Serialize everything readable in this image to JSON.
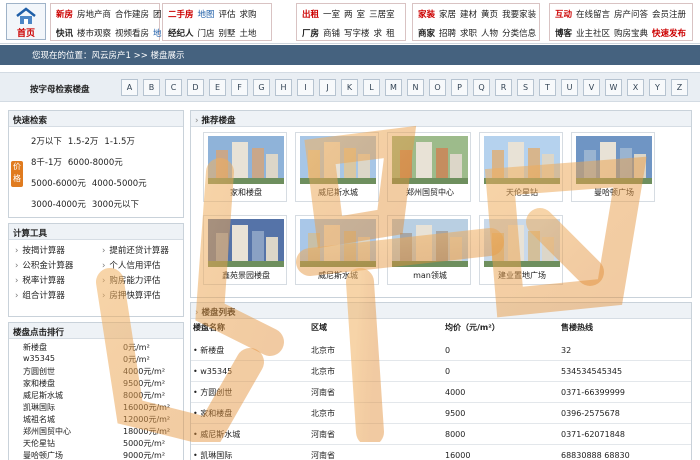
{
  "nav": {
    "home_label": "首页",
    "blocks": [
      {
        "row1": [
          {
            "t": "新房",
            "s": "red"
          },
          {
            "t": "房地产商",
            "s": ""
          },
          {
            "t": "合作建房",
            "s": ""
          },
          {
            "t": "团购",
            "s": ""
          }
        ],
        "row2": [
          {
            "t": "快讯",
            "s": "bold"
          },
          {
            "t": "楼市观察",
            "s": ""
          },
          {
            "t": "视频看房",
            "s": ""
          },
          {
            "t": "地图",
            "s": "blue"
          }
        ]
      },
      {
        "row1": [
          {
            "t": "二手房",
            "s": "red"
          },
          {
            "t": "地图",
            "s": "blue"
          },
          {
            "t": "评估",
            "s": ""
          },
          {
            "t": "求购",
            "s": ""
          }
        ],
        "row2": [
          {
            "t": "经纪人",
            "s": "bold"
          },
          {
            "t": "门店",
            "s": ""
          },
          {
            "t": "别墅",
            "s": ""
          },
          {
            "t": "土地",
            "s": ""
          }
        ]
      },
      {
        "row1": [
          {
            "t": "出租",
            "s": "red"
          },
          {
            "t": "一室",
            "s": ""
          },
          {
            "t": "两",
            "s": ""
          },
          {
            "t": "室",
            "s": ""
          },
          {
            "t": "三居室",
            "s": ""
          }
        ],
        "row2": [
          {
            "t": "厂房",
            "s": "bold"
          },
          {
            "t": "商铺",
            "s": ""
          },
          {
            "t": "写字楼",
            "s": ""
          },
          {
            "t": "求",
            "s": ""
          },
          {
            "t": "租",
            "s": ""
          }
        ]
      },
      {
        "row1": [
          {
            "t": "家装",
            "s": "red"
          },
          {
            "t": "家居",
            "s": ""
          },
          {
            "t": "建材",
            "s": ""
          },
          {
            "t": "黄页",
            "s": ""
          },
          {
            "t": "我要家装",
            "s": ""
          }
        ],
        "row2": [
          {
            "t": "商家",
            "s": "bold"
          },
          {
            "t": "招聘",
            "s": ""
          },
          {
            "t": "求职",
            "s": ""
          },
          {
            "t": "人物",
            "s": ""
          },
          {
            "t": "分类信息",
            "s": ""
          }
        ]
      },
      {
        "row1": [
          {
            "t": "互动",
            "s": "red"
          },
          {
            "t": "在线留言",
            "s": ""
          },
          {
            "t": "房产问答",
            "s": ""
          },
          {
            "t": "会员注册",
            "s": ""
          }
        ],
        "row2": [
          {
            "t": "博客",
            "s": "bold"
          },
          {
            "t": "业主社区",
            "s": ""
          },
          {
            "t": "购房宝典",
            "s": ""
          },
          {
            "t": "快速发布",
            "s": "red"
          }
        ]
      }
    ]
  },
  "breadcrumb": "您现在的位置：风云房产1 >> 楼盘展示",
  "alpha": {
    "label": "按字母检索楼盘",
    "letters": [
      "A",
      "B",
      "C",
      "D",
      "E",
      "F",
      "G",
      "H",
      "I",
      "J",
      "K",
      "L",
      "M",
      "N",
      "O",
      "P",
      "Q",
      "R",
      "S",
      "T",
      "U",
      "V",
      "W",
      "X",
      "Y",
      "Z"
    ]
  },
  "quick": {
    "title": "快速检索",
    "tag": "价格",
    "rows": [
      [
        "2万以下",
        "1.5-2万",
        "1-1.5万"
      ],
      [
        "8千-1万",
        "6000-8000元"
      ],
      [
        "5000-6000元",
        "4000-5000元"
      ],
      [
        "3000-4000元",
        "3000元以下"
      ]
    ]
  },
  "tools": {
    "title": "计算工具",
    "items": [
      [
        "按揭计算器",
        "提前还贷计算器"
      ],
      [
        "公积金计算器",
        "个人信用评估"
      ],
      [
        "税率计算器",
        "购房能力评估"
      ],
      [
        "组合计算器",
        "房押快算评估"
      ]
    ]
  },
  "rank": {
    "title": "楼盘点击排行",
    "items": [
      {
        "name": "新楼盘",
        "price": "0元/m²"
      },
      {
        "name": "w35345",
        "price": "0元/m²"
      },
      {
        "name": "方圆创世",
        "price": "4000元/m²"
      },
      {
        "name": "家和楼盘",
        "price": "9500元/m²"
      },
      {
        "name": "威尼斯水城",
        "price": "8000元/m²"
      },
      {
        "name": "凯琳国际",
        "price": "16000元/m²"
      },
      {
        "name": "城祖名城",
        "price": "12000元/m²"
      },
      {
        "name": "郑州国贸中心",
        "price": "18000元/m²"
      },
      {
        "name": "天伦星钻",
        "price": "5000元/m²"
      },
      {
        "name": "曼哈顿广场",
        "price": "9000元/m²"
      }
    ]
  },
  "recommend": {
    "title": "推荐楼盘",
    "items": [
      "家和楼盘",
      "威尼斯水城",
      "郑州国贸中心",
      "天伦星钻",
      "曼哈顿广场",
      "鑫苑景园楼盘",
      "威尼斯水城",
      "man领城",
      "建业置地广场"
    ]
  },
  "list": {
    "title": "楼盘列表",
    "headers": [
      "楼盘名称",
      "区域",
      "均价（元/m²）",
      "售楼热线"
    ],
    "rows": [
      [
        "新楼盘",
        "北京市",
        "0",
        "32"
      ],
      [
        "w35345",
        "北京市",
        "0",
        "534534545345"
      ],
      [
        "方圆创世",
        "河南省",
        "4000",
        "0371-66399999"
      ],
      [
        "家和楼盘",
        "北京市",
        "9500",
        "0396-2575678"
      ],
      [
        "威尼斯水城",
        "河南省",
        "8000",
        "0371-62071848"
      ],
      [
        "凯琳国际",
        "河南省",
        "16000",
        "68830888 68830"
      ]
    ]
  },
  "colors": {
    "accent_red": "#cc0000",
    "header_blue": "#45627f",
    "price_tag": "#e07b1f"
  }
}
